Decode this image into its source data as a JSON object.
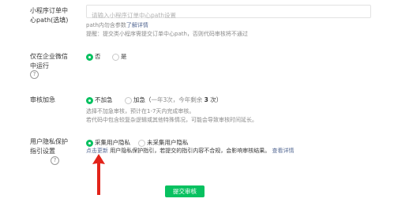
{
  "page_path": {
    "label": "小程序订单中心path(选填)",
    "placeholder": "请输入小程序订单中心path设置",
    "note_prefix": "path内勿含参数",
    "note_link": "了解详情",
    "note_warning": "提醒：提交类小程序需提交订单中心path，否则代码审核将不通过"
  },
  "wecom_only": {
    "label": "仅在企业微信中运行",
    "options": [
      "否",
      "是"
    ],
    "selected": "否"
  },
  "expedite": {
    "label": "审核加急",
    "option_no": "不加急",
    "option_yes_prefix": "加急（",
    "option_yes_remaining_label": "一年3次，今年剩余",
    "option_yes_count": "3",
    "option_yes_suffix": "次）",
    "selected": "不加急",
    "hint_line1": "选择不加急审核，预计在1-7天内完成审核。",
    "hint_line2": "若代码中包含较复杂逻辑或其他特殊情况，可能会导致审核时间延长。"
  },
  "privacy": {
    "label": "用户隐私保护指引设置",
    "options": [
      "采集用户隐私",
      "未采集用户隐私"
    ],
    "selected": "采集用户隐私",
    "update_link": "点击更新",
    "note": "用户隐私保护指引，若提交的指引内容不合规，会影响审核结果。",
    "details_link": "查看详情"
  },
  "submit_label": "提交审核",
  "help_icon_glyph": "?",
  "colors": {
    "accent": "#07c160",
    "link": "#576b95",
    "arrow": "#e2231a"
  }
}
